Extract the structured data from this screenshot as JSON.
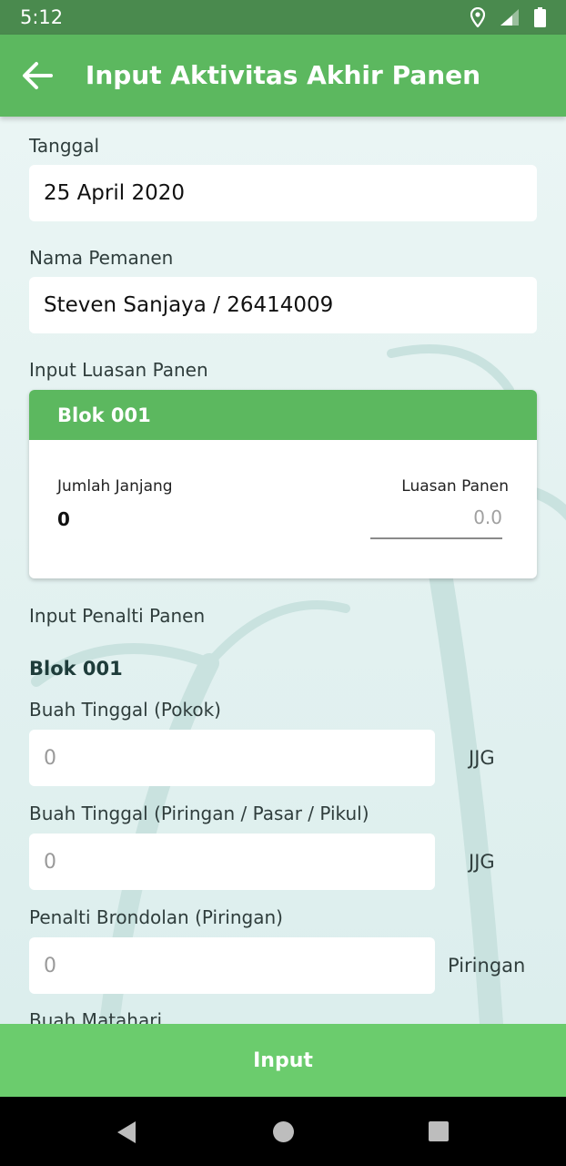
{
  "status_bar": {
    "time": "5:12"
  },
  "app_bar": {
    "title": "Input Aktivitas Akhir Panen"
  },
  "form": {
    "tanggal": {
      "label": "Tanggal",
      "value": "25 April 2020"
    },
    "nama_pemanen": {
      "label": "Nama Pemanen",
      "value": "Steven Sanjaya / 26414009"
    },
    "luasan": {
      "label": "Input Luasan Panen",
      "card": {
        "title": "Blok 001",
        "jumlah_label": "Jumlah Janjang",
        "jumlah_value": "0",
        "luasan_label": "Luasan Panen",
        "luasan_placeholder": "0.0"
      }
    },
    "penalti": {
      "label": "Input Penalti Panen",
      "blok_title": "Blok 001",
      "fields": [
        {
          "label": "Buah Tinggal (Pokok)",
          "placeholder": "0",
          "unit": "JJG"
        },
        {
          "label": "Buah Tinggal (Piringan / Pasar / Pikul)",
          "placeholder": "0",
          "unit": "JJG"
        },
        {
          "label": "Penalti Brondolan (Piringan)",
          "placeholder": "0",
          "unit": "Piringan"
        },
        {
          "label": "Buah Matahari"
        }
      ]
    }
  },
  "submit_button": {
    "label": "Input"
  },
  "colors": {
    "primary": "#5cb85f",
    "button": "#6bcc6d",
    "status_bar": "#4a8a4e",
    "background": "#e6f2f1"
  }
}
